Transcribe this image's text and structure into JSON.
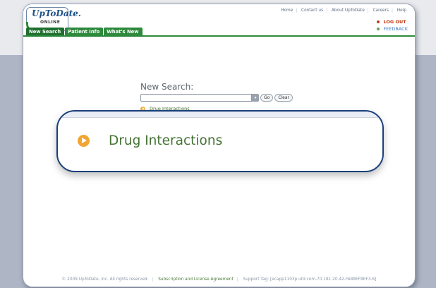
{
  "logo": {
    "word": "UpToDate.",
    "sub": "ONLINE"
  },
  "top_links": [
    "Home",
    "Contact us",
    "About UpToDate",
    "Careers",
    "Help"
  ],
  "account": {
    "logout": "LOG OUT",
    "feedback": "FEEDBACK"
  },
  "tabs": [
    "New Search",
    "Patient Info",
    "What's New"
  ],
  "search": {
    "title": "New Search:",
    "input_value": "",
    "go_label": "Go",
    "clear_label": "Clear",
    "dropdown_icon": "chevron-down-icon"
  },
  "drug_link": {
    "label": "Drug Interactions",
    "icon": "play-circle-icon"
  },
  "zoom": {
    "label": "Drug Interactions",
    "icon": "play-circle-icon"
  },
  "footer": {
    "copyright": "© 2009 UpToDate, Inc. All rights reserved.",
    "license": "Subscription and License Agreement",
    "support": "Support Tag: [ecapp1103p.utd.com-70.181.20.42-FA88EF8EF3-6]"
  },
  "colors": {
    "brand_green": "#2d8a3c",
    "logout_red": "#c23a12",
    "callout_border": "#193f7a",
    "icon_orange": "#f1a533",
    "link_green": "#447233"
  }
}
